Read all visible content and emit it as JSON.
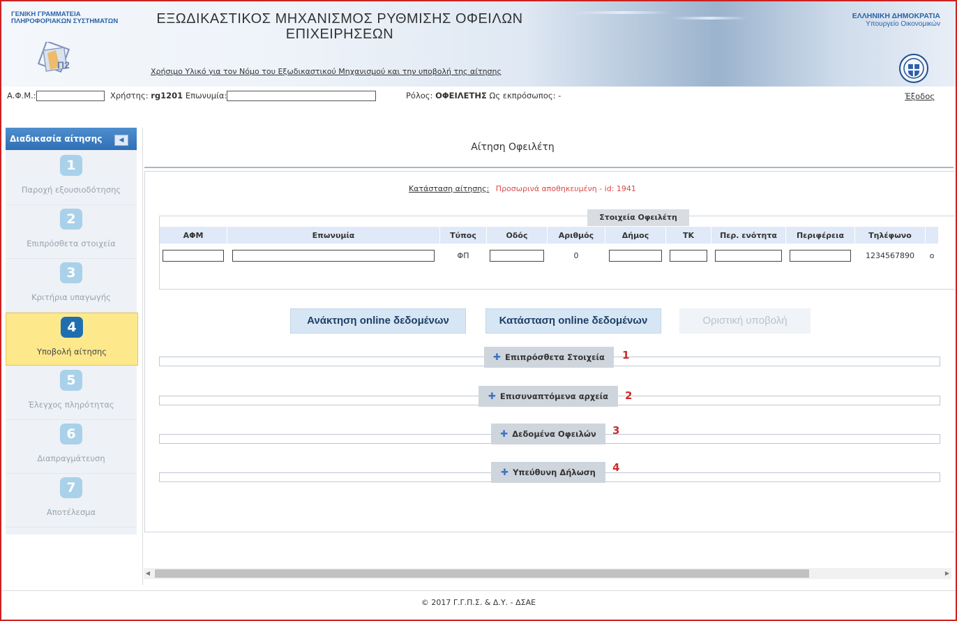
{
  "header": {
    "org_left_line1": "ΓΕΝΙΚΗ ΓΡΑΜΜΑΤΕΙΑ",
    "org_left_line2": "ΠΛΗΡΟΦΟΡΙΑΚΩΝ ΣΥΣΤΗΜΑΤΩΝ",
    "title_line1": "ΕΞΩΔΙΚΑΣΤΙΚΟΣ ΜΗΧΑΝΙΣΜΟΣ ΡΥΘΜΙΣΗΣ ΟΦΕΙΛΩΝ",
    "title_line2": "ΕΠΙΧΕΙΡΗΣΕΩΝ",
    "useful_link": "Χρήσιμο Υλικό για τον Νόμο του Εξωδικαστικού Μηχανισμού και την υποβολή της αίτησης",
    "org_right_line1": "ΕΛΛΗΝΙΚΗ ΔΗΜΟΚΡΑΤΙΑ",
    "org_right_line2": "Υπουργείο Οικονομικών"
  },
  "userbar": {
    "afm_label": "Α.Φ.Μ.:",
    "user_label": "Χρήστης:",
    "user_value": "rg1201",
    "name_label": "Επωνυμία:",
    "role_label": "Ρόλος:",
    "role_value": "ΟΦΕΙΛΕΤΗΣ",
    "rep_label": "Ως εκπρόσωπος:",
    "rep_value": "-",
    "logout": "Έξοδος"
  },
  "sidebar": {
    "header": "Διαδικασία αίτησης",
    "collapse": "◀",
    "steps": [
      {
        "num": "1",
        "label": "Παροχή εξουσιοδότησης"
      },
      {
        "num": "2",
        "label": "Επιπρόσθετα στοιχεία"
      },
      {
        "num": "3",
        "label": "Κριτήρια υπαγωγής"
      },
      {
        "num": "4",
        "label": "Υποβολή αίτησης"
      },
      {
        "num": "5",
        "label": "Έλεγχος πληρότητας"
      },
      {
        "num": "6",
        "label": "Διαπραγμάτευση"
      },
      {
        "num": "7",
        "label": "Αποτέλεσμα"
      }
    ],
    "active_step": "4"
  },
  "main": {
    "title": "Αίτηση Οφειλέτη",
    "status_label": "Κατάσταση αίτησης:",
    "status_value": "Προσωρινά αποθηκευμένη - id: 1941",
    "debtor_tab": "Στοιχεία Οφειλέτη",
    "table": {
      "headers": [
        "ΑΦΜ",
        "Επωνυμία",
        "Τύπος",
        "Οδός",
        "Αριθμός",
        "Δήμος",
        "ΤΚ",
        "Περ. ενότητα",
        "Περιφέρεια",
        "Τηλέφωνο"
      ],
      "row": {
        "type": "ΦΠ",
        "number": "0",
        "phone": "1234567890",
        "overflow": "o"
      }
    },
    "buttons": {
      "retrieve": "Ανάκτηση online δεδομένων",
      "status_online": "Κατάσταση online δεδομένων",
      "final_submit": "Οριστική υποβολή"
    },
    "sections": [
      {
        "label": "Επιπρόσθετα Στοιχεία",
        "marker": "1"
      },
      {
        "label": "Επισυναπτόμενα αρχεία",
        "marker": "2"
      },
      {
        "label": "Δεδομένα Οφειλών",
        "marker": "3"
      },
      {
        "label": "Υπεύθυνη Δήλωση",
        "marker": "4"
      }
    ]
  },
  "footer": {
    "text": "© 2017 Γ.Γ.Π.Σ. & Δ.Υ. - ΔΣΑΕ"
  },
  "colors": {
    "accent": "#2f6fb4",
    "active_step": "#fde98c",
    "status_red": "#d94b4b",
    "marker_red": "#cc2b2b"
  }
}
